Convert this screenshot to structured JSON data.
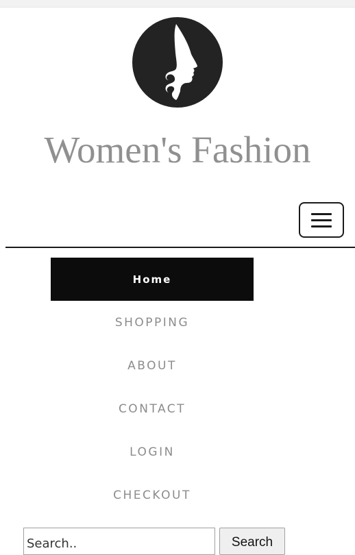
{
  "header": {
    "logo_icon": "woman-silhouette-logo-icon",
    "title": "Women's Fashion",
    "menu_toggle_icon": "hamburger-menu-icon"
  },
  "nav": {
    "items": [
      {
        "label": "Home",
        "active": true
      },
      {
        "label": "SHOPPING",
        "active": false
      },
      {
        "label": "ABOUT",
        "active": false
      },
      {
        "label": "CONTACT",
        "active": false
      },
      {
        "label": "LOGIN",
        "active": false
      },
      {
        "label": "CHECKOUT",
        "active": false
      }
    ]
  },
  "search": {
    "placeholder": "Search..",
    "button_label": "Search"
  },
  "colors": {
    "title": "#909090",
    "nav_text": "#8c8c8c",
    "nav_active_bg": "#0c0c0c",
    "logo_circle": "#232323"
  }
}
